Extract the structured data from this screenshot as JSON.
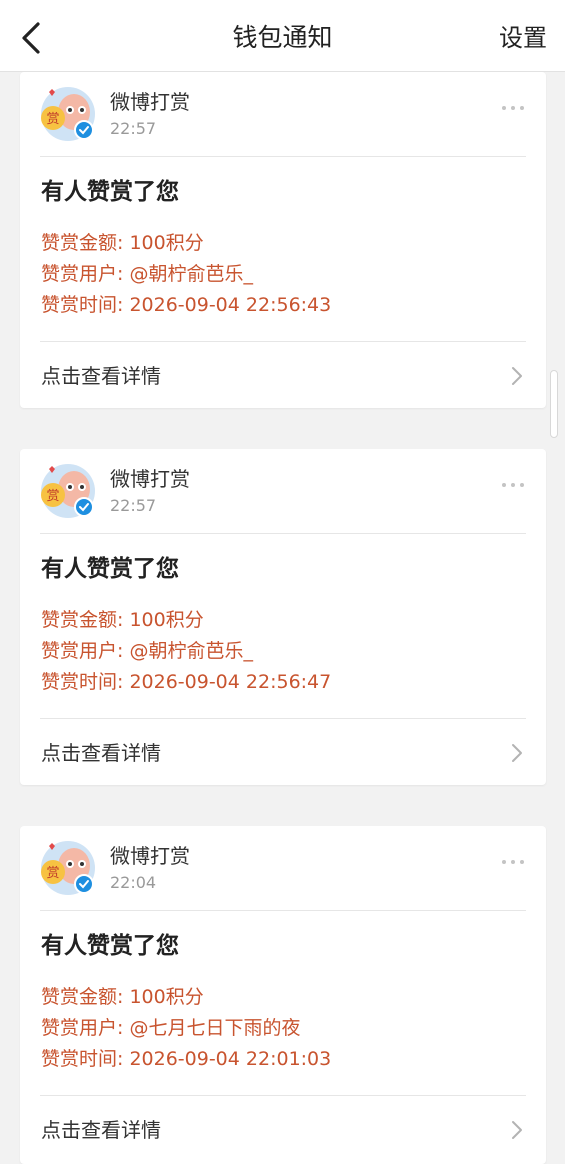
{
  "nav": {
    "title": "钱包通知",
    "settings_label": "设置"
  },
  "cards": [
    {
      "sender": "微博打赏",
      "time": "22:57",
      "headline": "有人赞赏了您",
      "amount": "赞赏金额: 100积分",
      "user": "赞赏用户: @朝柠俞芭乐_",
      "reward_time": "赞赏时间: 2026-09-04 22:56:43",
      "detail_label": "点击查看详情"
    },
    {
      "sender": "微博打赏",
      "time": "22:57",
      "headline": "有人赞赏了您",
      "amount": "赞赏金额: 100积分",
      "user": "赞赏用户: @朝柠俞芭乐_",
      "reward_time": "赞赏时间: 2026-09-04 22:56:47",
      "detail_label": "点击查看详情"
    },
    {
      "sender": "微博打赏",
      "time": "22:04",
      "headline": "有人赞赏了您",
      "amount": "赞赏金额: 100积分",
      "user": "赞赏用户: @七月七日下雨的夜",
      "reward_time": "赞赏时间: 2026-09-04 22:01:03",
      "detail_label": "点击查看详情"
    }
  ],
  "avatar": {
    "badge_text": "赏"
  },
  "colors": {
    "accent_text": "#c8542f",
    "verified_badge": "#1e8fe0",
    "background": "#f2f2f2"
  },
  "icons": {
    "back": "chevron-left-icon",
    "more": "more-dots-icon",
    "detail": "chevron-right-icon",
    "verified": "verified-badge-icon"
  }
}
